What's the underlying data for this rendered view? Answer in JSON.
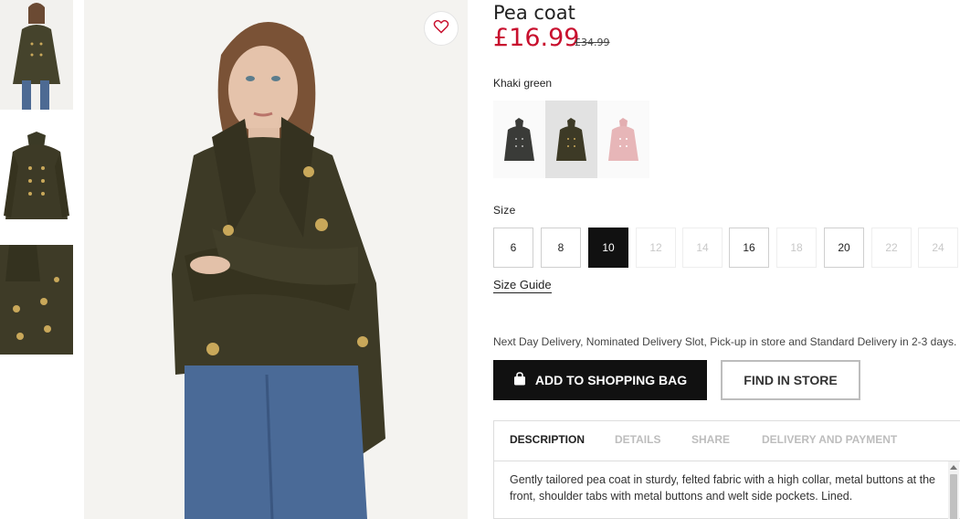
{
  "product": {
    "title": "Pea coat",
    "price_current": "£16.99",
    "price_original": "£34.99"
  },
  "thumbnails": [
    {
      "name": "model-full-length",
      "selected": false
    },
    {
      "name": "coat-front",
      "selected": false
    },
    {
      "name": "coat-collar-detail",
      "selected": false
    }
  ],
  "favorite_icon": "heart-icon",
  "color": {
    "selected_label": "Khaki green",
    "swatches": [
      {
        "name": "dark-grey",
        "color": "#3a3b38",
        "selected": false
      },
      {
        "name": "khaki-green",
        "color": "#3d3a26",
        "selected": true
      },
      {
        "name": "light-pink",
        "color": "#e7b6b8",
        "selected": false
      }
    ]
  },
  "size": {
    "label": "Size",
    "options": [
      {
        "label": "6",
        "state": "available"
      },
      {
        "label": "8",
        "state": "available"
      },
      {
        "label": "10",
        "state": "selected"
      },
      {
        "label": "12",
        "state": "unavailable"
      },
      {
        "label": "14",
        "state": "unavailable"
      },
      {
        "label": "16",
        "state": "available"
      },
      {
        "label": "18",
        "state": "unavailable"
      },
      {
        "label": "20",
        "state": "available"
      },
      {
        "label": "22",
        "state": "unavailable"
      },
      {
        "label": "24",
        "state": "unavailable"
      }
    ],
    "guide_label": "Size Guide"
  },
  "delivery_note": "Next Day Delivery, Nominated Delivery Slot, Pick-up in store and Standard Delivery in 2-3 days.",
  "actions": {
    "add_to_bag": "ADD TO SHOPPING BAG",
    "add_to_bag_icon": "shopping-bag-icon",
    "find_in_store": "FIND IN STORE"
  },
  "info_tabs": {
    "tabs": [
      {
        "label": "DESCRIPTION",
        "active": true
      },
      {
        "label": "DETAILS",
        "active": false
      },
      {
        "label": "SHARE",
        "active": false
      },
      {
        "label": "DELIVERY AND PAYMENT",
        "active": false
      }
    ],
    "description": "Gently tailored pea coat in sturdy, felted fabric with a high collar, metal buttons at the front, shoulder tabs with metal buttons and welt side pockets. Lined."
  },
  "colors": {
    "price_red": "#c8102e",
    "button_black": "#111111",
    "coat_khaki": "#3d3a26"
  }
}
